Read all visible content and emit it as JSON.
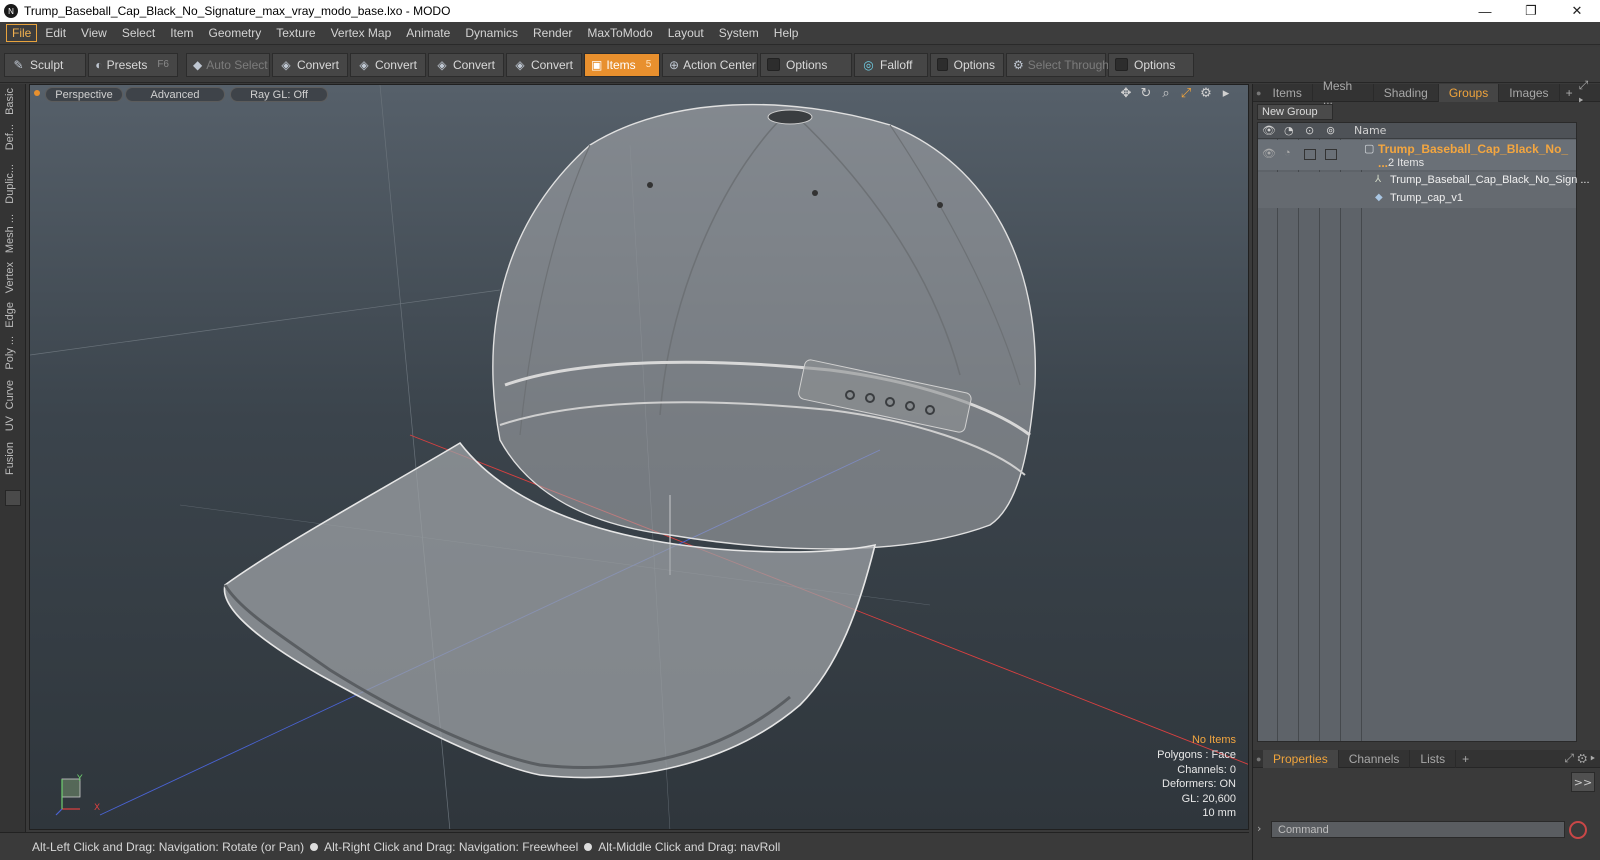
{
  "window": {
    "title": "Trump_Baseball_Cap_Black_No_Signature_max_vray_modo_base.lxo - MODO",
    "app_icon": "modo-logo-icon",
    "minimize": "—",
    "restore": "❐",
    "close": "✕"
  },
  "menu": [
    "File",
    "Edit",
    "View",
    "Select",
    "Item",
    "Geometry",
    "Texture",
    "Vertex Map",
    "Animate",
    "Dynamics",
    "Render",
    "MaxToModo",
    "Layout",
    "System",
    "Help"
  ],
  "toolbar": {
    "sculpt": "Sculpt",
    "presets": "Presets",
    "presets_key": "F6",
    "auto_select": "Auto Select",
    "convert1": "Convert",
    "convert2": "Convert",
    "convert3": "Convert",
    "convert4": "Convert",
    "items": "Items",
    "items_key": "5",
    "action_center": "Action Center",
    "options1": "Options",
    "falloff": "Falloff",
    "options2": "Options",
    "select_through": "Select Through",
    "options3": "Options"
  },
  "left_tabs": [
    "Basic",
    "Def...",
    "Duplic...",
    "Mesh ...",
    "Vertex",
    "Edge",
    "Poly ...",
    "Curve",
    "UV",
    "Fusion"
  ],
  "viewport": {
    "view_mode": "Perspective",
    "shading": "Advanced",
    "raygl": "Ray GL: Off",
    "stats": {
      "title": "No Items",
      "polygons": "Polygons : Face",
      "channels": "Channels: 0",
      "deformers": "Deformers: ON",
      "gl": "GL: 20,600",
      "scale": "10 mm"
    },
    "axis_y": "Y",
    "axis_x": "X"
  },
  "statusbar": {
    "hint1": "Alt-Left Click and Drag: Navigation: Rotate (or Pan)",
    "hint2": "Alt-Right Click and Drag: Navigation: Freewheel",
    "hint3": "Alt-Middle Click and Drag: navRoll"
  },
  "right_panel": {
    "tabs": [
      "Items",
      "Mesh ...",
      "Shading",
      "Groups",
      "Images"
    ],
    "active_tab": "Groups",
    "new_group": "New Group",
    "col_name": "Name",
    "group_name": "Trump_Baseball_Cap_Black_No_ ...",
    "group_count": "2 Items",
    "children": [
      "Trump_Baseball_Cap_Black_No_Sign ...",
      "Trump_cap_v1"
    ],
    "bottom_tabs": [
      "Properties",
      "Channels",
      "Lists"
    ],
    "bottom_active": "Properties",
    "expand": ">>",
    "command_placeholder": "Command"
  },
  "colors": {
    "accent": "#e8902e",
    "highlight_text": "#f3a640",
    "axis_x": "#d94040",
    "axis_y": "#dddddd",
    "axis_z": "#4060d0"
  }
}
